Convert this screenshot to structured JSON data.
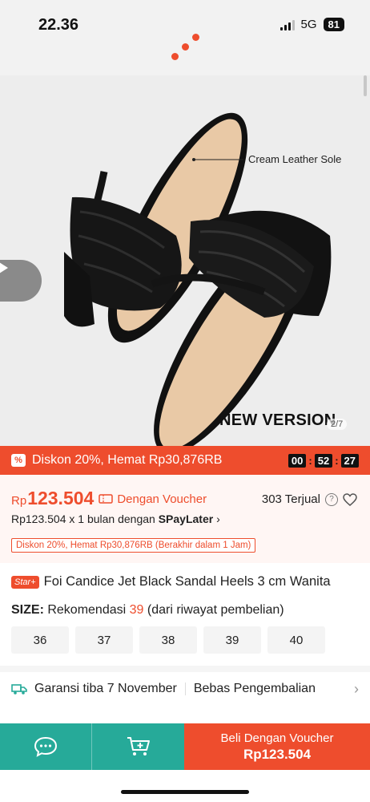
{
  "status_bar": {
    "time": "22.36",
    "network": "5G",
    "battery": "81"
  },
  "gallery": {
    "sole_label": "Cream Leather Sole",
    "badge": "NEW VERSION",
    "counter": "2/7"
  },
  "flash_sale": {
    "icon": "%",
    "text": "Diskon 20%, Hemat Rp30,876RB",
    "timer": {
      "h": "00",
      "m": "52",
      "s": "27"
    }
  },
  "price": {
    "currency": "Rp",
    "amount": "123.504",
    "voucher_label": "Dengan Voucher",
    "sold": "303 Terjual",
    "help_icon": "?",
    "installment_prefix": "Rp123.504 x 1 bulan dengan",
    "installment_brand": "SPayLater",
    "chevron": "›",
    "discount_chip": "Diskon 20%, Hemat Rp30,876RB (Berakhir dalam 1 Jam)"
  },
  "product": {
    "badge": "Star+",
    "name": "Foi Candice Jet Black Sandal Heels 3 cm Wanita"
  },
  "size": {
    "label": "SIZE:",
    "rec_prefix": "Rekomendasi",
    "rec_value": "39",
    "rec_suffix": "(dari riwayat pembelian)",
    "options": [
      "36",
      "37",
      "38",
      "39",
      "40"
    ]
  },
  "shipping": {
    "guarantee": "Garansi tiba 7 November",
    "returns": "Bebas Pengembalian",
    "chevron": "›"
  },
  "bottom_bar": {
    "buy_line1": "Beli Dengan Voucher",
    "buy_line2": "Rp123.504"
  },
  "colors": {
    "accent": "#ee4d2d",
    "teal": "#26aa99"
  }
}
